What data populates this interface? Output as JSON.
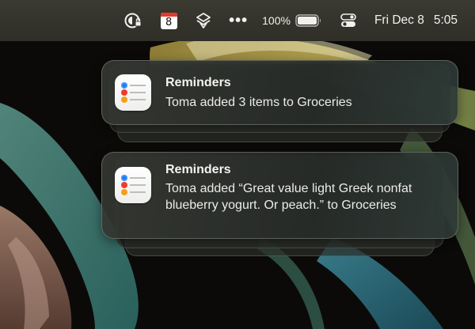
{
  "menubar": {
    "icons": [
      "focus-mode-icon",
      "calendar-icon",
      "layers-icon",
      "more-icon",
      "battery-icon",
      "control-center-icon"
    ],
    "calendar_day": "8",
    "more_glyph": "•••",
    "battery_percent": "100%",
    "battery_level": 1.0,
    "date": "Fri Dec 8",
    "time": "5:05"
  },
  "notifications": [
    {
      "app": "Reminders",
      "message": "Toma added 3 items to Groceries",
      "icon": "reminders-app-icon"
    },
    {
      "app": "Reminders",
      "message": "Toma added “Great value light Greek nonfat blueberry yogurt. Or peach.” to Groceries",
      "icon": "reminders-app-icon"
    }
  ],
  "colors": {
    "menubar": "#34332b",
    "card": "#2f322d",
    "reminder_blue": "#1f7cf5",
    "reminder_red": "#ef3a31",
    "reminder_orange": "#f59e1a",
    "calendar_red": "#e33b30"
  }
}
